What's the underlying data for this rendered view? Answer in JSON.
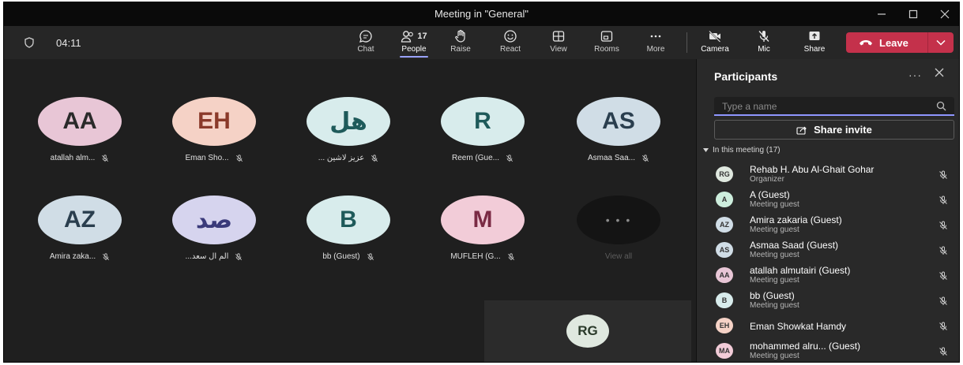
{
  "window": {
    "title": "Meeting in \"General\""
  },
  "toolbar": {
    "timer": "04:11",
    "people_count": "17",
    "buttons": [
      {
        "id": "chat",
        "label": "Chat",
        "icon": "chat-icon"
      },
      {
        "id": "people",
        "label": "People",
        "icon": "people-icon",
        "active": true
      },
      {
        "id": "raise",
        "label": "Raise",
        "icon": "hand-icon"
      },
      {
        "id": "react",
        "label": "React",
        "icon": "smiley-icon"
      },
      {
        "id": "view",
        "label": "View",
        "icon": "grid-icon"
      },
      {
        "id": "rooms",
        "label": "Rooms",
        "icon": "rooms-icon"
      },
      {
        "id": "more",
        "label": "More",
        "icon": "ellipsis-icon"
      },
      {
        "id": "camera",
        "label": "Camera",
        "icon": "camera-off-icon"
      },
      {
        "id": "mic",
        "label": "Mic",
        "icon": "mic-off-icon"
      },
      {
        "id": "share",
        "label": "Share",
        "icon": "share-tray-icon"
      }
    ],
    "leave_label": "Leave",
    "leave_color": "#c4314b"
  },
  "stage": {
    "tiles": [
      {
        "initials": "AA",
        "name": "atallah alm...",
        "color": "#e8c6d6",
        "initials_color": "#2a2a2a"
      },
      {
        "initials": "EH",
        "name": "Eman Sho...",
        "color": "#f5d2c6",
        "initials_color": "#8a3a2a"
      },
      {
        "initials": "هل",
        "name": "... عزيز لاشين",
        "color": "#d8ecec",
        "initials_color": "#1e5a5a"
      },
      {
        "initials": "R",
        "name": "Reem (Gue...",
        "color": "#d8ecec",
        "initials_color": "#1e5a5a"
      },
      {
        "initials": "AS",
        "name": "Asmaa Saa...",
        "color": "#d0dde6",
        "initials_color": "#2a3e4e"
      },
      {
        "initials": "AZ",
        "name": "Amira zaka...",
        "color": "#d0dde6",
        "initials_color": "#2a3e4e"
      },
      {
        "initials": "صد",
        "name": "...الم ال سعد",
        "color": "#d6d4ee",
        "initials_color": "#3a3a7a"
      },
      {
        "initials": "B",
        "name": "bb (Guest)",
        "color": "#d8ecec",
        "initials_color": "#1e5a5a"
      },
      {
        "initials": "M",
        "name": "MUFLEH (G...",
        "color": "#f2ccd8",
        "initials_color": "#7a2a44"
      }
    ],
    "view_all": {
      "dots": "• • •",
      "label": "View all"
    },
    "self_view": {
      "initials": "RG",
      "color": "#dfe8df"
    }
  },
  "panel": {
    "title": "Participants",
    "more": "···",
    "search_placeholder": "Type a name",
    "share_invite": "Share invite",
    "section_label": "In this meeting (17)",
    "participants": [
      {
        "initials": "RG",
        "name": "Rehab H. Abu Al-Ghait Gohar",
        "role": "Organizer",
        "color": "#dfe8df"
      },
      {
        "initials": "A",
        "name": "A (Guest)",
        "role": "Meeting guest",
        "color": "#cdeedd"
      },
      {
        "initials": "AZ",
        "name": "Amira zakaria (Guest)",
        "role": "Meeting guest",
        "color": "#d0dde6"
      },
      {
        "initials": "AS",
        "name": "Asmaa Saad (Guest)",
        "role": "Meeting guest",
        "color": "#d0dde6"
      },
      {
        "initials": "AA",
        "name": "atallah almutairi (Guest)",
        "role": "Meeting guest",
        "color": "#e8c6d6"
      },
      {
        "initials": "B",
        "name": "bb (Guest)",
        "role": "Meeting guest",
        "color": "#d8ecec"
      },
      {
        "initials": "EH",
        "name": "Eman Showkat Hamdy",
        "role": "",
        "color": "#f5d2c6"
      },
      {
        "initials": "MA",
        "name": "mohammed alru... (Guest)",
        "role": "Meeting guest",
        "color": "#f2ccd8"
      }
    ]
  }
}
